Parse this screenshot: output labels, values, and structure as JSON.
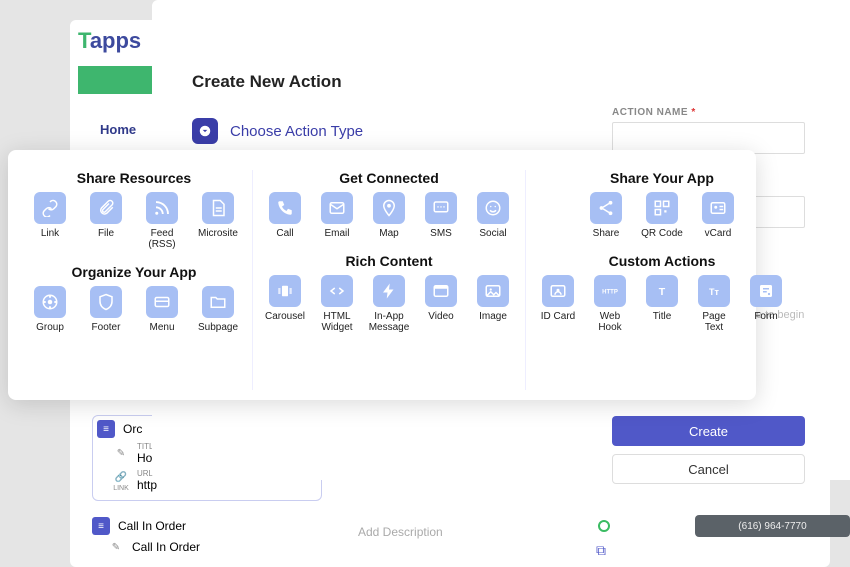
{
  "logo": {
    "t": "T",
    "rest": "apps"
  },
  "nav": {
    "home": "Home"
  },
  "dialog": {
    "title": "Create New Action",
    "choose_label": "Choose Action Type",
    "action_name_label": "ACTION NAME",
    "required_mark": "*",
    "hint": "e to begin",
    "create": "Create",
    "cancel": "Cancel"
  },
  "picker": {
    "sections": [
      {
        "title": "Share Resources",
        "items": [
          {
            "label": "Link",
            "icon": "link"
          },
          {
            "label": "File",
            "icon": "paperclip"
          },
          {
            "label": "Feed (RSS)",
            "icon": "rss"
          },
          {
            "label": "Microsite",
            "icon": "filetext"
          }
        ]
      },
      {
        "title": "Get Connected",
        "items": [
          {
            "label": "Call",
            "icon": "phone"
          },
          {
            "label": "Email",
            "icon": "mail"
          },
          {
            "label": "Map",
            "icon": "pin"
          },
          {
            "label": "SMS",
            "icon": "sms"
          },
          {
            "label": "Social",
            "icon": "smile"
          }
        ]
      },
      {
        "title": "Share Your App",
        "items": [
          {
            "label": "Share",
            "icon": "share"
          },
          {
            "label": "QR Code",
            "icon": "qr"
          },
          {
            "label": "vCard",
            "icon": "vcard"
          }
        ]
      },
      {
        "title": "Organize Your App",
        "items": [
          {
            "label": "Group",
            "icon": "group"
          },
          {
            "label": "Footer",
            "icon": "shield"
          },
          {
            "label": "Menu",
            "icon": "menu"
          },
          {
            "label": "Subpage",
            "icon": "folder"
          }
        ]
      },
      {
        "title": "Rich Content",
        "items": [
          {
            "label": "Carousel",
            "icon": "carousel"
          },
          {
            "label": "HTML Widget",
            "icon": "code"
          },
          {
            "label": "In-App Message",
            "icon": "bolt"
          },
          {
            "label": "Video",
            "icon": "video"
          },
          {
            "label": "Image",
            "icon": "image"
          }
        ]
      },
      {
        "title": "Custom Actions",
        "items": [
          {
            "label": "ID Card",
            "icon": "idcard"
          },
          {
            "label": "Web Hook",
            "icon": "http"
          },
          {
            "label": "Title",
            "icon": "title"
          },
          {
            "label": "Page Text",
            "icon": "pagetext"
          },
          {
            "label": "Form",
            "icon": "form"
          }
        ]
      }
    ]
  },
  "tree": {
    "item1_title_label": "TITLE",
    "item1_title": "Orc",
    "item1_sub_title_label": "TITLE",
    "item1_sub_title": "Hor",
    "item1_url_label": "URL",
    "item1_url": "http",
    "item2_title": "Call In Order",
    "item2_sub_title": "Call In Order",
    "desc_placeholder": "Add Description",
    "link_badge": "Link"
  },
  "phone": "(616) 964-7770"
}
